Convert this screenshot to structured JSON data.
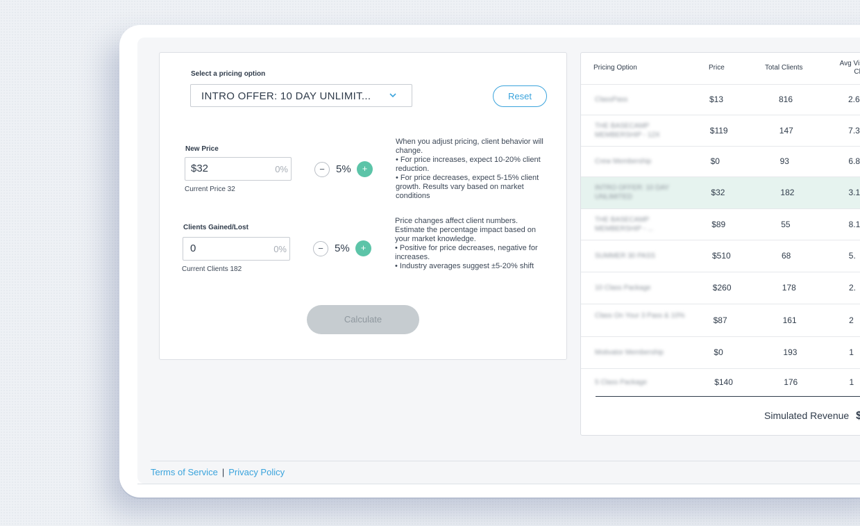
{
  "pricing": {
    "select_label": "Select a pricing option",
    "selected_option": "INTRO OFFER: 10 DAY UNLIMIT...",
    "reset_label": "Reset"
  },
  "new_price": {
    "label": "New Price",
    "currency": "$",
    "value": "32",
    "pct": "0%",
    "current": "Current Price 32",
    "step": "5%",
    "help": [
      "When you adjust pricing, client behavior will change.",
      "• For price increases, expect 10-20% client reduction.",
      "• For price decreases, expect 5-15% client growth. Results vary based on market conditions"
    ]
  },
  "clients": {
    "label": "Clients Gained/Lost",
    "value": "0",
    "pct": "0%",
    "current": "Current Clients 182",
    "step": "5%",
    "help": [
      "Price changes affect client numbers. Estimate the percentage impact based on your market knowledge.",
      "• Positive for price decreases, negative for increases.",
      "• Industry averages suggest ±5-20% shift"
    ]
  },
  "calculate_label": "Calculate",
  "table": {
    "headers": {
      "option": "Pricing Option",
      "price": "Price",
      "clients": "Total Clients",
      "avg_visits": "Avg Visits/ Client"
    },
    "rows": [
      {
        "name": "ClassPass",
        "price": "$13",
        "clients": "816",
        "avg": "2.6"
      },
      {
        "name": "THE BASECAMP MEMBERSHIP - 12X",
        "price": "$119",
        "clients": "147",
        "avg": "7.3"
      },
      {
        "name": "Crew Membership",
        "price": "$0",
        "clients": "93",
        "avg": "6.8"
      },
      {
        "name": "INTRO OFFER: 10 DAY UNLIMITED",
        "price": "$32",
        "clients": "182",
        "avg": "3.1"
      },
      {
        "name": "THE BASECAMP MEMBERSHIP - ...",
        "price": "$89",
        "clients": "55",
        "avg": "8.1"
      },
      {
        "name": "SUMMER 30 PASS",
        "price": "$510",
        "clients": "68",
        "avg": "5."
      },
      {
        "name": "10 Class Package",
        "price": "$260",
        "clients": "178",
        "avg": "2."
      },
      {
        "name": "Class On Your 3 Pass & 10%",
        "price": "$87",
        "clients": "161",
        "avg": "2"
      },
      {
        "name": "Motivator Membership",
        "price": "$0",
        "clients": "193",
        "avg": "1"
      },
      {
        "name": "5 Class Package",
        "price": "$140",
        "clients": "176",
        "avg": "1"
      }
    ],
    "simulated_revenue_label": "Simulated Revenue",
    "simulated_revenue_value": "$"
  },
  "footer": {
    "terms": "Terms of Service",
    "separator": "|",
    "privacy": "Privacy Policy"
  }
}
